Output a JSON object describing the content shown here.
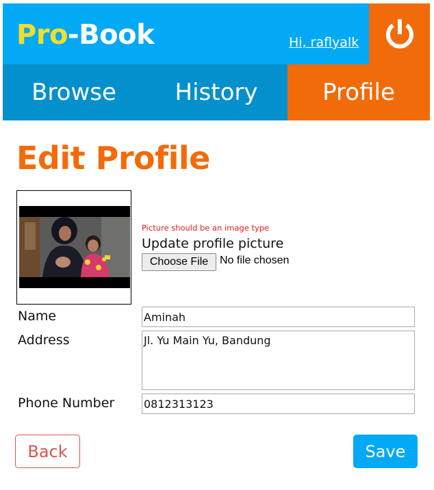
{
  "header": {
    "brand_part1": "Pro",
    "brand_part2": "-Book",
    "greeting": "Hi, raflyalk",
    "logout_icon": "power-icon",
    "colors": {
      "primary": "#03a9f4",
      "accent": "#f26b0a",
      "brand_highlight": "#f5dd2b",
      "nav": "#0490cc"
    }
  },
  "nav": {
    "items": [
      {
        "label": "Browse"
      },
      {
        "label": "History"
      },
      {
        "label": "Profile",
        "active": true
      }
    ]
  },
  "page": {
    "title": "Edit Profile"
  },
  "picture": {
    "error": "Picture should be an image type",
    "label": "Update profile picture",
    "choose_button": "Choose File",
    "file_status": "No file chosen"
  },
  "form": {
    "name_label": "Name",
    "name_value": "Aminah",
    "address_label": "Address",
    "address_value": "Jl. Yu Main Yu, Bandung",
    "phone_label": "Phone Number",
    "phone_value": "0812313123"
  },
  "actions": {
    "back_label": "Back",
    "save_label": "Save"
  }
}
